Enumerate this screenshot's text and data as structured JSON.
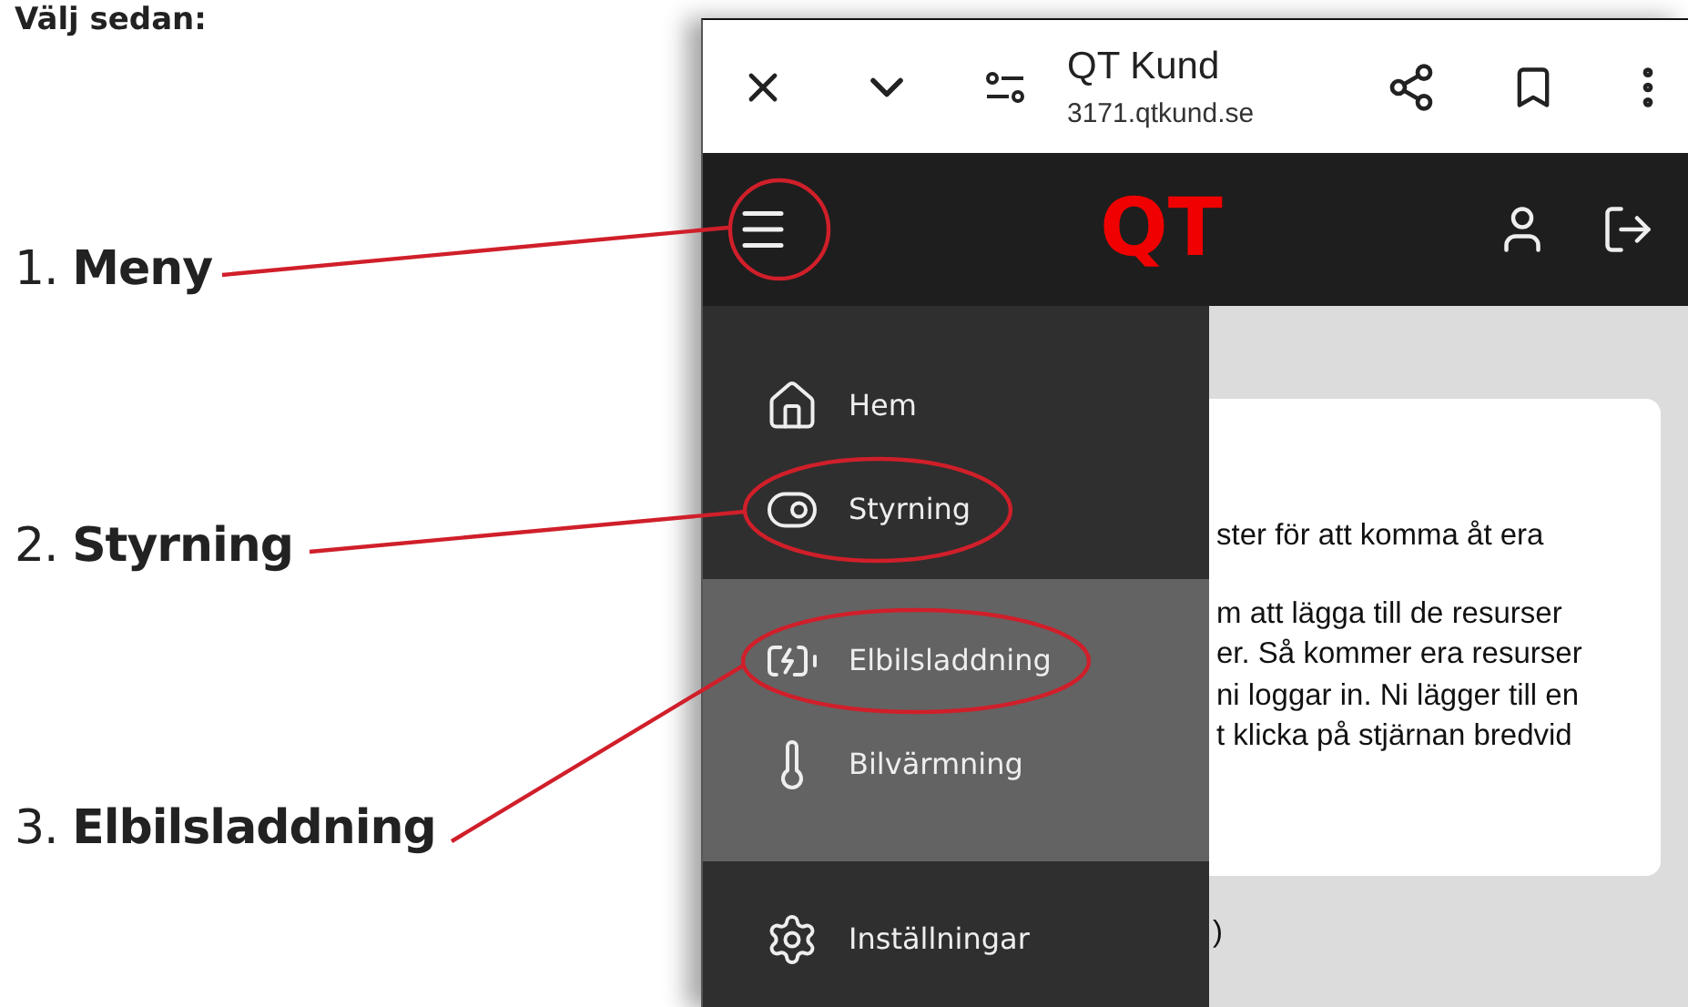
{
  "heading": "Välj sedan:",
  "annotations": [
    {
      "number": "1.",
      "label": "Meny"
    },
    {
      "number": "2.",
      "label": "Styrning"
    },
    {
      "number": "3.",
      "label": "Elbilsladdning"
    }
  ],
  "browser": {
    "title": "QT Kund",
    "url": "3171.qtkund.se"
  },
  "app_header": {
    "logo": "QT"
  },
  "menu": [
    {
      "kind": "home",
      "label": "Hem"
    },
    {
      "kind": "toggle",
      "label": "Styrning",
      "expanded": true,
      "children": [
        {
          "kind": "charging",
          "label": "Elbilsladdning"
        },
        {
          "kind": "thermometer",
          "label": "Bilvärmning"
        }
      ]
    },
    {
      "kind": "settings",
      "label": "Inställningar"
    }
  ],
  "card": {
    "paragraphs": [
      [
        "ster för att komma åt era"
      ],
      [
        "m att lägga till de resurser",
        "er. Så kommer era resurser",
        "ni loggar in. Ni lägger till en",
        "t klicka på stjärnan bredvid"
      ]
    ]
  },
  "below_card": ")"
}
